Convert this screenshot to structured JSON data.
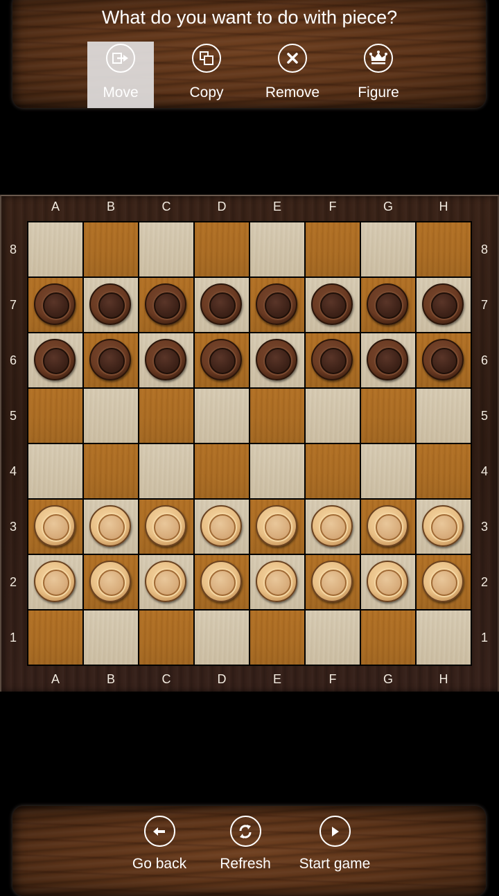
{
  "top_panel": {
    "prompt": "What do you want to do with piece?",
    "actions": [
      {
        "id": "move",
        "label": "Move",
        "icon": "move-arrow-icon",
        "selected": true
      },
      {
        "id": "copy",
        "label": "Copy",
        "icon": "copy-icon",
        "selected": false
      },
      {
        "id": "remove",
        "label": "Remove",
        "icon": "close-x-icon",
        "selected": false
      },
      {
        "id": "figure",
        "label": "Figure",
        "icon": "crown-icon",
        "selected": false
      }
    ]
  },
  "board": {
    "columns": [
      "A",
      "B",
      "C",
      "D",
      "E",
      "F",
      "G",
      "H"
    ],
    "rows": [
      "8",
      "7",
      "6",
      "5",
      "4",
      "3",
      "2",
      "1"
    ],
    "colors": {
      "light_square": "#d4c7ad",
      "dark_square": "#a86a22",
      "frame": "#33201a",
      "dark_piece": "#4a2a1a",
      "light_piece": "#e6bf88"
    },
    "pieces": {
      "8": [
        "",
        "",
        "",
        "",
        "",
        "",
        "",
        ""
      ],
      "7": [
        "dark",
        "dark",
        "dark",
        "dark",
        "dark",
        "dark",
        "dark",
        "dark"
      ],
      "6": [
        "dark",
        "dark",
        "dark",
        "dark",
        "dark",
        "dark",
        "dark",
        "dark"
      ],
      "5": [
        "",
        "",
        "",
        "",
        "",
        "",
        "",
        ""
      ],
      "4": [
        "",
        "",
        "",
        "",
        "",
        "",
        "",
        ""
      ],
      "3": [
        "light",
        "light",
        "light",
        "light",
        "light",
        "light",
        "light",
        "light"
      ],
      "2": [
        "light",
        "light",
        "light",
        "light",
        "light",
        "light",
        "light",
        "light"
      ],
      "1": [
        "",
        "",
        "",
        "",
        "",
        "",
        "",
        ""
      ]
    }
  },
  "bottom_panel": {
    "actions": [
      {
        "id": "go_back",
        "label": "Go back",
        "icon": "arrow-left-icon"
      },
      {
        "id": "refresh",
        "label": "Refresh",
        "icon": "refresh-icon"
      },
      {
        "id": "start_game",
        "label": "Start game",
        "icon": "play-icon"
      }
    ]
  }
}
